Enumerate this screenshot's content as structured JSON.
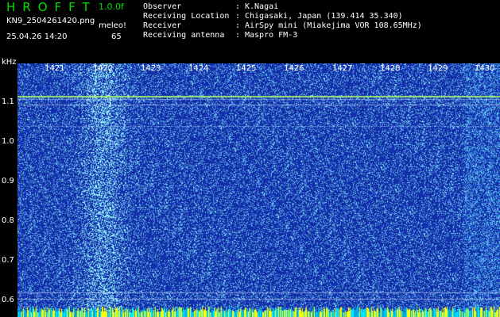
{
  "app": {
    "title": "HROFFT",
    "version": "1.0.0f"
  },
  "file": {
    "name": "KN9_2504261420.png",
    "datetime": "25.04.26 14:20"
  },
  "meta": {
    "label": "meleo!",
    "value": "65"
  },
  "header": {
    "rows": [
      {
        "key": "Observer",
        "value": "K.Nagai"
      },
      {
        "key": "Receiving Location",
        "value": "Chigasaki, Japan (139.414 35.340)"
      },
      {
        "key": "Receiver",
        "value": "AirSpy mini (Miakejima VOR 108.65MHz)"
      },
      {
        "key": "Receiving antenna",
        "value": "Maspro FM-3"
      }
    ]
  },
  "axes": {
    "y_unit": "kHz",
    "y_ticks": [
      "1.1",
      "1.0",
      "0.9",
      "0.8",
      "0.7",
      "0.6"
    ],
    "x_ticks": [
      "1421",
      "1422",
      "1423",
      "1424",
      "1425",
      "1426",
      "1427",
      "1428",
      "1429",
      "1430"
    ]
  },
  "colors": {
    "background": "#000000",
    "title_green": "#00e000",
    "spectrogram_base": "#1a2fa8",
    "noise_cyan": "#5fd0ff",
    "carrier_green": "#a8f070",
    "bottom_strip": "#ffff00"
  }
}
